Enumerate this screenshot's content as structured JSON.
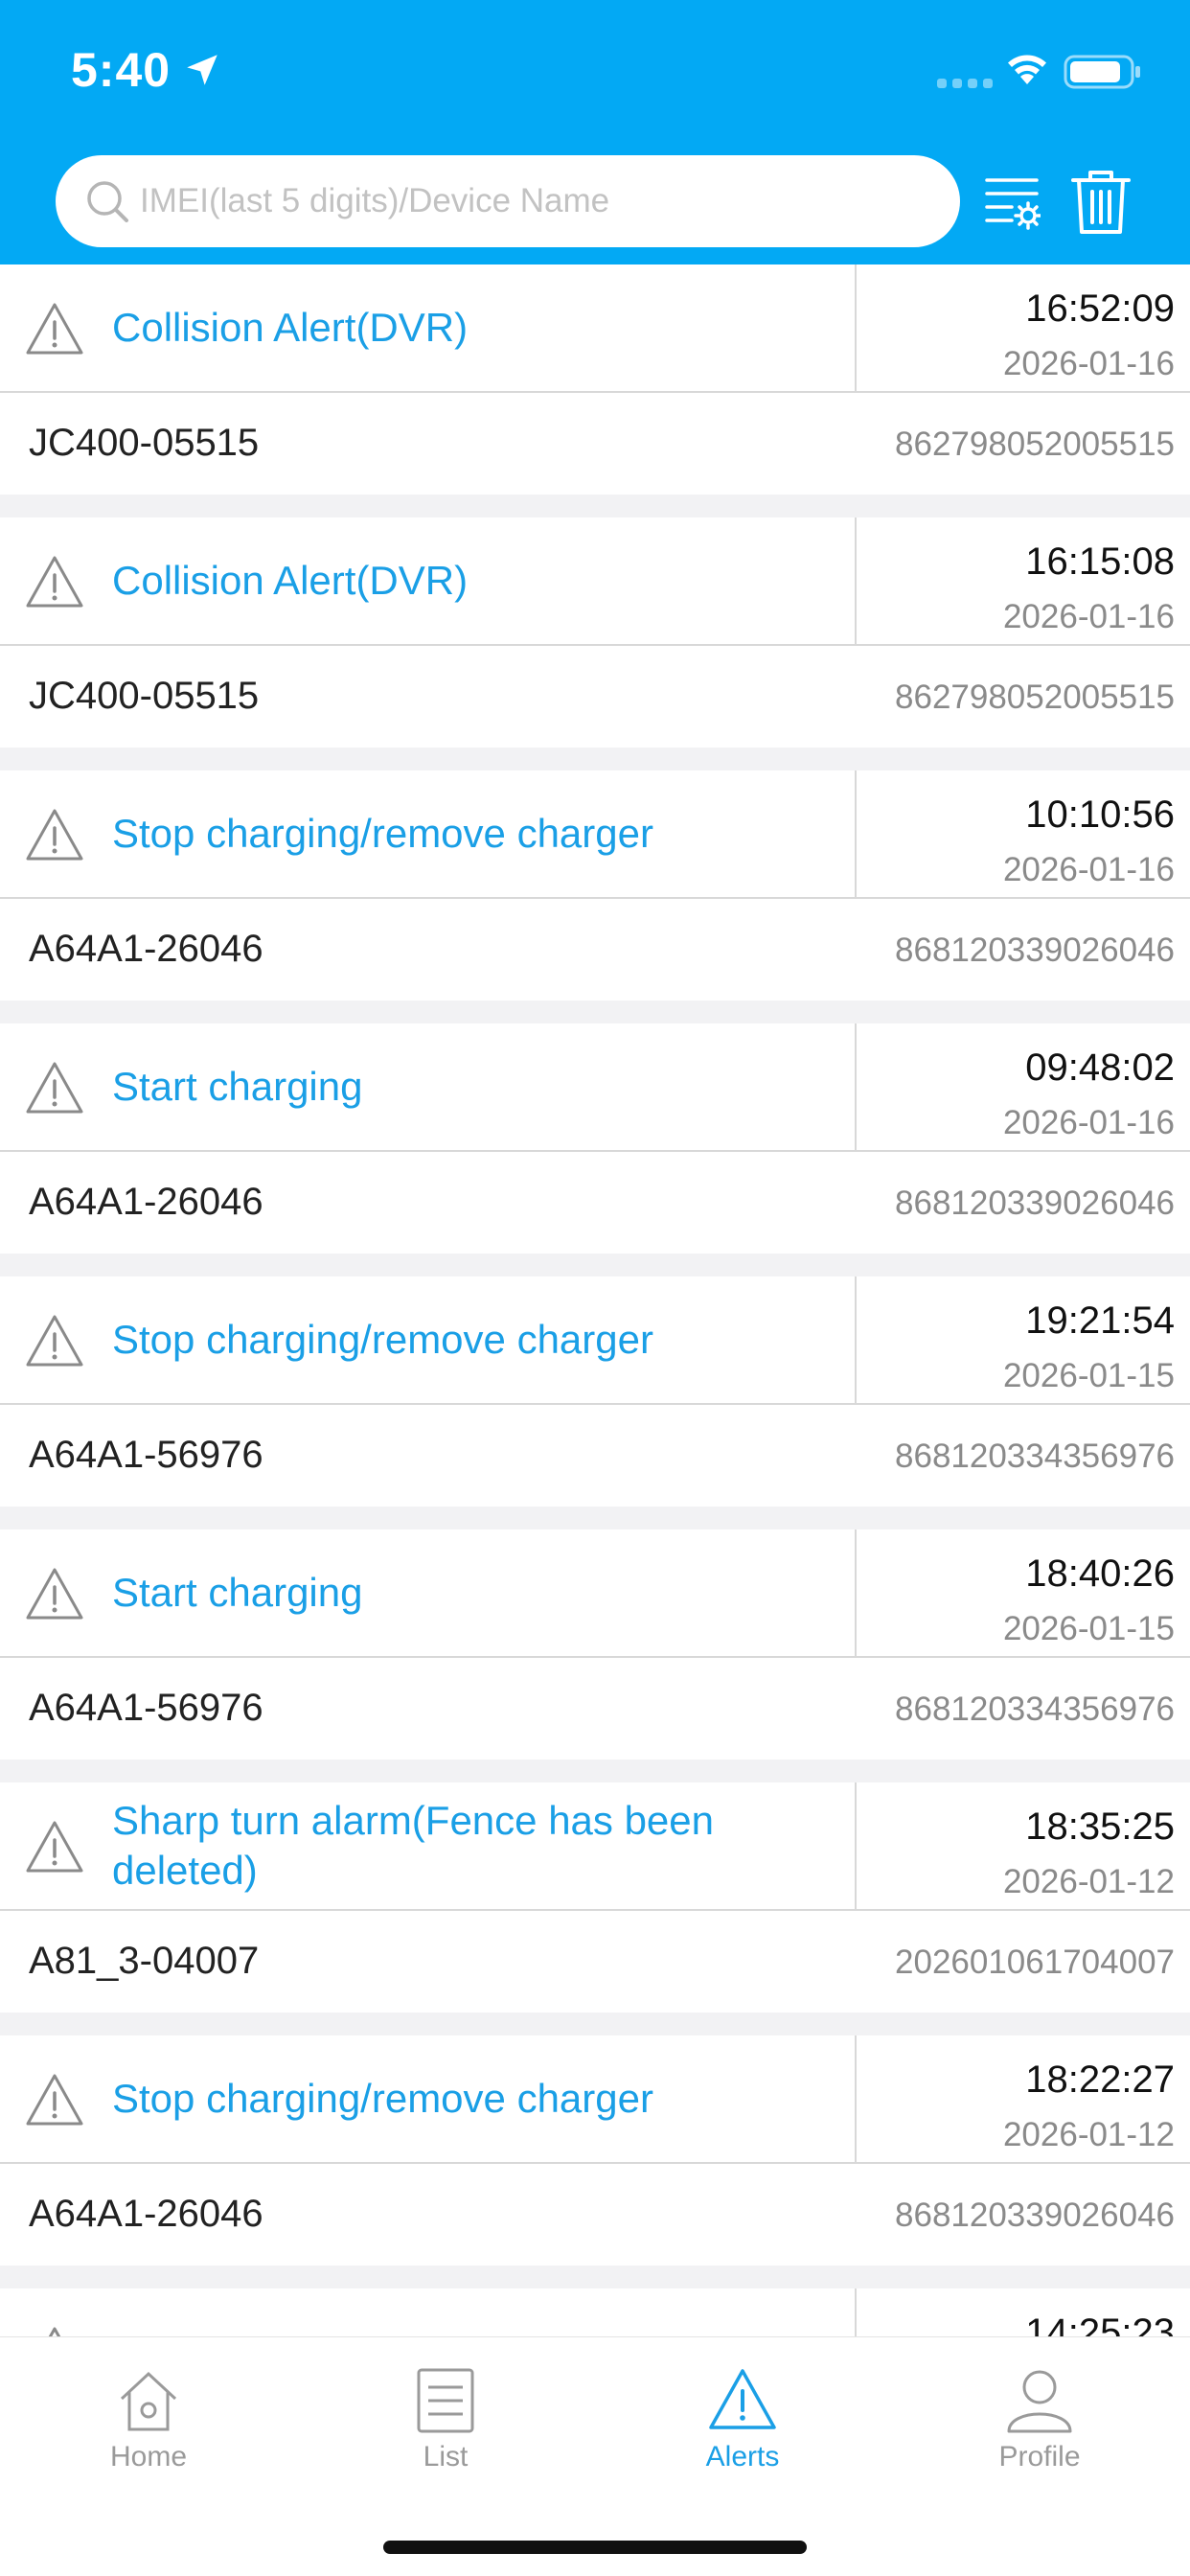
{
  "theme": {
    "primary": "#03A9F4",
    "accent": "#1a9fe6"
  },
  "status_bar": {
    "time": "5:40"
  },
  "search": {
    "placeholder": "IMEI(last 5 digits)/Device Name",
    "value": ""
  },
  "alerts": [
    {
      "title": "Collision Alert(DVR)",
      "time": "16:52:09",
      "date": "2026-01-16",
      "device": "JC400-05515",
      "imei": "862798052005515"
    },
    {
      "title": "Collision Alert(DVR)",
      "time": "16:15:08",
      "date": "2026-01-16",
      "device": "JC400-05515",
      "imei": "862798052005515"
    },
    {
      "title": "Stop charging/remove charger",
      "time": "10:10:56",
      "date": "2026-01-16",
      "device": "A64A1-26046",
      "imei": "868120339026046"
    },
    {
      "title": "Start charging",
      "time": "09:48:02",
      "date": "2026-01-16",
      "device": "A64A1-26046",
      "imei": "868120339026046"
    },
    {
      "title": "Stop charging/remove charger",
      "time": "19:21:54",
      "date": "2026-01-15",
      "device": "A64A1-56976",
      "imei": "868120334356976"
    },
    {
      "title": "Start charging",
      "time": "18:40:26",
      "date": "2026-01-15",
      "device": "A64A1-56976",
      "imei": "868120334356976"
    },
    {
      "title": "Sharp turn alarm(Fence has been deleted)",
      "time": "18:35:25",
      "date": "2026-01-12",
      "device": "A81_3-04007",
      "imei": "202601061704007"
    },
    {
      "title": "Stop charging/remove charger",
      "time": "18:22:27",
      "date": "2026-01-12",
      "device": "A64A1-26046",
      "imei": "868120339026046"
    },
    {
      "title": "",
      "time": "14:25:23",
      "date": "",
      "device": "",
      "imei": ""
    }
  ],
  "tabs": [
    {
      "label": "Home",
      "icon": "home-icon",
      "active": false
    },
    {
      "label": "List",
      "icon": "list-icon",
      "active": false
    },
    {
      "label": "Alerts",
      "icon": "alert-icon",
      "active": true
    },
    {
      "label": "Profile",
      "icon": "profile-icon",
      "active": false
    }
  ]
}
